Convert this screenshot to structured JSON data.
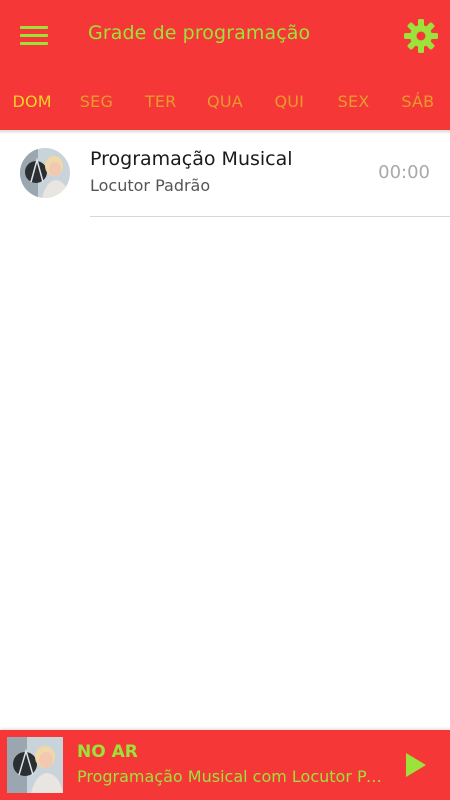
{
  "appbar": {
    "title": "Grade de programação",
    "menu_icon": "hamburger-menu-icon",
    "settings_icon": "gear-icon"
  },
  "tabs": [
    {
      "label": "DOM",
      "active": true
    },
    {
      "label": "SEG",
      "active": false
    },
    {
      "label": "TER",
      "active": false
    },
    {
      "label": "QUA",
      "active": false
    },
    {
      "label": "QUI",
      "active": false
    },
    {
      "label": "SEX",
      "active": false
    },
    {
      "label": "SÁB",
      "active": false
    }
  ],
  "schedule": [
    {
      "title": "Programação Musical",
      "host": "Locutor Padrão",
      "time": "00:00"
    }
  ],
  "player": {
    "status": "NO AR",
    "now_playing": "Programação Musical com Locutor Padrão",
    "play_icon": "play-icon"
  },
  "colors": {
    "primary": "#f63737",
    "accent_green": "#9de23a",
    "tab_active": "#f3d32a",
    "tab_inactive": "#e89a2c"
  }
}
